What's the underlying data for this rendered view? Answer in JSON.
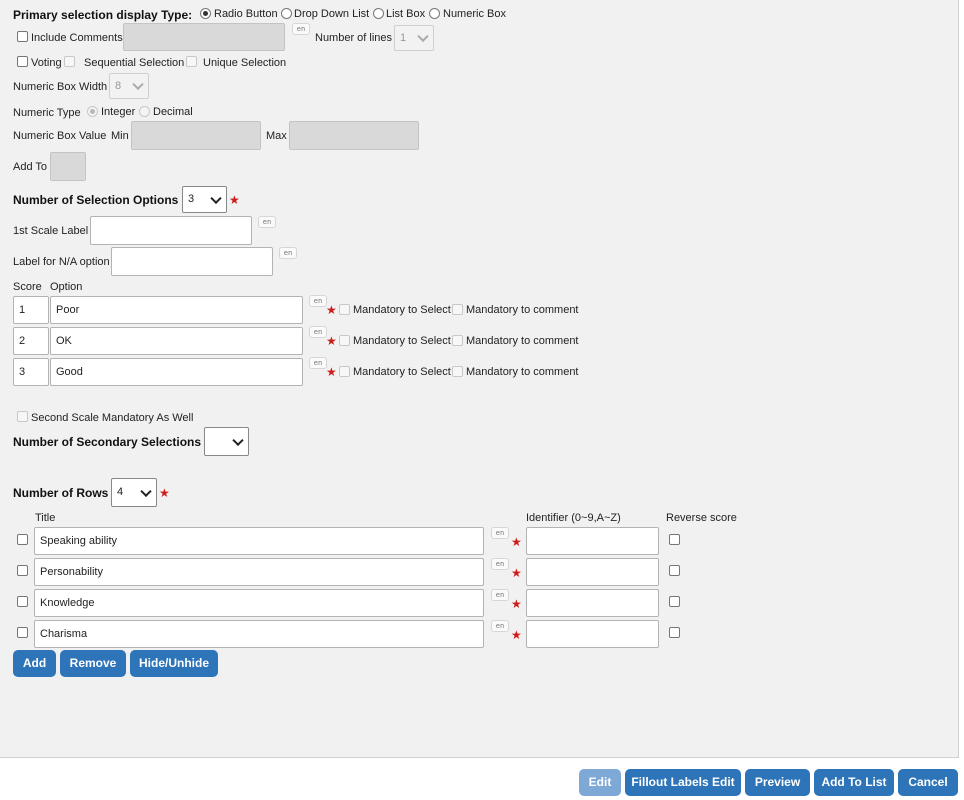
{
  "display_type": {
    "label": "Primary selection display Type:",
    "options": [
      "Radio Button",
      "Drop Down List",
      "List Box",
      "Numeric Box"
    ],
    "selected": "Radio Button"
  },
  "include_comments": {
    "label": "Include Comments",
    "value": "",
    "lang": "en"
  },
  "number_of_lines": {
    "label": "Number of lines",
    "value": "1"
  },
  "voting_row": {
    "voting": "Voting",
    "sequential": "Sequential Selection",
    "unique": "Unique Selection"
  },
  "numeric_box_width": {
    "label": "Numeric Box Width",
    "value": "8"
  },
  "numeric_type": {
    "label": "Numeric Type",
    "integer": "Integer",
    "decimal": "Decimal",
    "selected": "Integer"
  },
  "numeric_box_value": {
    "label": "Numeric Box Value",
    "min_label": "Min",
    "max_label": "Max",
    "min": "",
    "max": ""
  },
  "add_to": {
    "label": "Add To",
    "value": ""
  },
  "selection_options": {
    "label": "Number of Selection Options",
    "value": "3"
  },
  "scale_label": {
    "label": "1st Scale Label",
    "value": "",
    "lang": "en"
  },
  "na_label": {
    "label": "Label for N/A option",
    "value": "",
    "lang": "en"
  },
  "options_table": {
    "score_header": "Score",
    "option_header": "Option",
    "mandatory_select": "Mandatory to Select",
    "mandatory_comment": "Mandatory to comment",
    "lang": "en",
    "rows": [
      {
        "score": "1",
        "option": "Poor"
      },
      {
        "score": "2",
        "option": "OK"
      },
      {
        "score": "3",
        "option": "Good"
      }
    ]
  },
  "second_scale": {
    "label": "Second Scale Mandatory As Well"
  },
  "secondary_selections": {
    "label": "Number of Secondary Selections",
    "value": ""
  },
  "rows_count": {
    "label": "Number of Rows",
    "value": "4"
  },
  "rows_table": {
    "title_header": "Title",
    "identifier_header": "Identifier (0~9,A~Z)",
    "reverse_header": "Reverse score",
    "lang": "en",
    "rows": [
      {
        "title": "Speaking ability",
        "identifier": ""
      },
      {
        "title": "Personability",
        "identifier": ""
      },
      {
        "title": "Knowledge",
        "identifier": ""
      },
      {
        "title": "Charisma",
        "identifier": ""
      }
    ]
  },
  "row_buttons": {
    "add": "Add",
    "remove": "Remove",
    "hide": "Hide/Unhide"
  },
  "footer": {
    "edit": "Edit",
    "fillout": "Fillout Labels Edit",
    "preview": "Preview",
    "add_to_list": "Add To List",
    "cancel": "Cancel"
  }
}
